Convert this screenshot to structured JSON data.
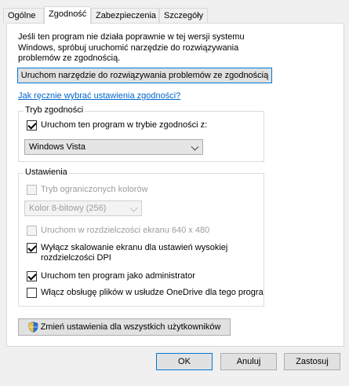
{
  "tabs": [
    {
      "label": "Ogólne",
      "active": false
    },
    {
      "label": "Zgodność",
      "active": true
    },
    {
      "label": "Zabezpieczenia",
      "active": false
    },
    {
      "label": "Szczegóły",
      "active": false
    }
  ],
  "intro": {
    "line1": "Jeśli ten program nie działa poprawnie w tej wersji systemu",
    "line2": "Windows, spróbuj uruchomić narzędzie do rozwiązywania",
    "line3": "problemów ze zgodnością."
  },
  "troubleshoot_button": "Uruchom narzędzie do rozwiązywania problemów ze zgodnością",
  "manual_link": "Jak ręcznie wybrać ustawienia zgodności?",
  "compat_group": {
    "legend": "Tryb zgodności",
    "checkbox_label": "Uruchom ten program w trybie zgodności z:",
    "checked": true,
    "os_selected": "Windows Vista"
  },
  "settings_group": {
    "legend": "Ustawienia",
    "reduced_color_label": "Tryb ograniczonych kolorów",
    "reduced_color_checked": false,
    "color_selected": "Kolor 8-bitowy (256)",
    "res640_label": "Uruchom w rozdzielczości ekranu 640 x 480",
    "res640_checked": false,
    "dpi_label_1": "Wyłącz skalowanie ekranu dla ustawień wysokiej",
    "dpi_label_2": "rozdzielczości DPI",
    "dpi_checked": true,
    "admin_label": "Uruchom ten program jako administrator",
    "admin_checked": true,
    "onedrive_label": "Włącz obsługę plików w usłudze OneDrive dla tego progra",
    "onedrive_checked": false
  },
  "change_all_button": "Zmień ustawienia dla wszystkich użytkowników",
  "footer": {
    "ok": "OK",
    "cancel": "Anuluj",
    "apply": "Zastosuj"
  }
}
